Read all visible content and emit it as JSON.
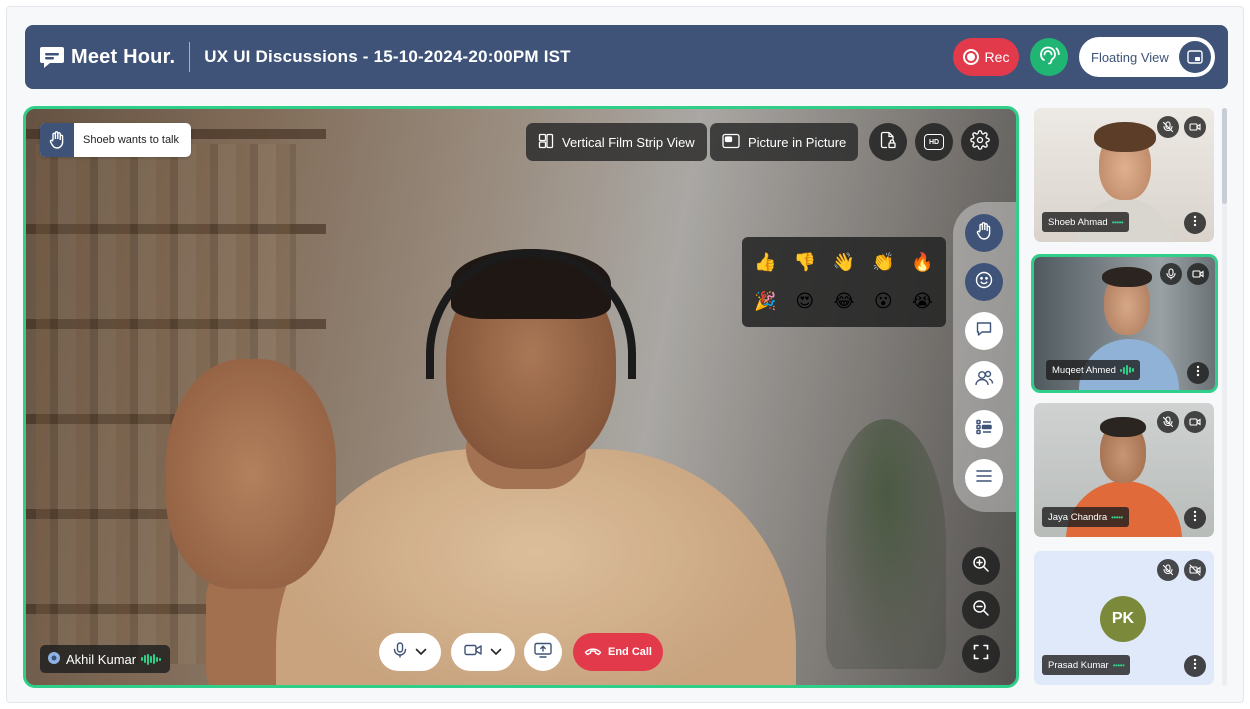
{
  "header": {
    "brand": "Meet Hour.",
    "meeting_title": "UX UI Discussions - 15-10-2024-20:00PM IST",
    "rec_label": "Rec",
    "floating_view_label": "Floating View"
  },
  "stage": {
    "raise_hand_notice": "Shoeb wants to talk",
    "vertical_film_strip_label": "Vertical Film Strip View",
    "picture_in_picture_label": "Picture in Picture",
    "hd_label": "HD",
    "speaker_name": "Akhil Kumar",
    "end_call_label": "End Call",
    "reactions": [
      "👍",
      "👎",
      "👋",
      "👏",
      "🔥",
      "🎉",
      "😍",
      "😂",
      "😮",
      "😭"
    ]
  },
  "participants": [
    {
      "name": "Shoeb Ahmad",
      "mic": "muted",
      "camera": "on"
    },
    {
      "name": "Muqeet Ahmed",
      "mic": "on",
      "camera": "on",
      "speaking": true
    },
    {
      "name": "Jaya Chandra",
      "mic": "muted",
      "camera": "on"
    },
    {
      "name": "Prasad Kumar",
      "mic": "muted",
      "camera": "off",
      "initials": "PK"
    }
  ],
  "colors": {
    "header_bg": "#3e5377",
    "accent_green": "#2fcf8a",
    "end_call_red": "#e23a4b",
    "avatar_olive": "#7b8a3a"
  }
}
